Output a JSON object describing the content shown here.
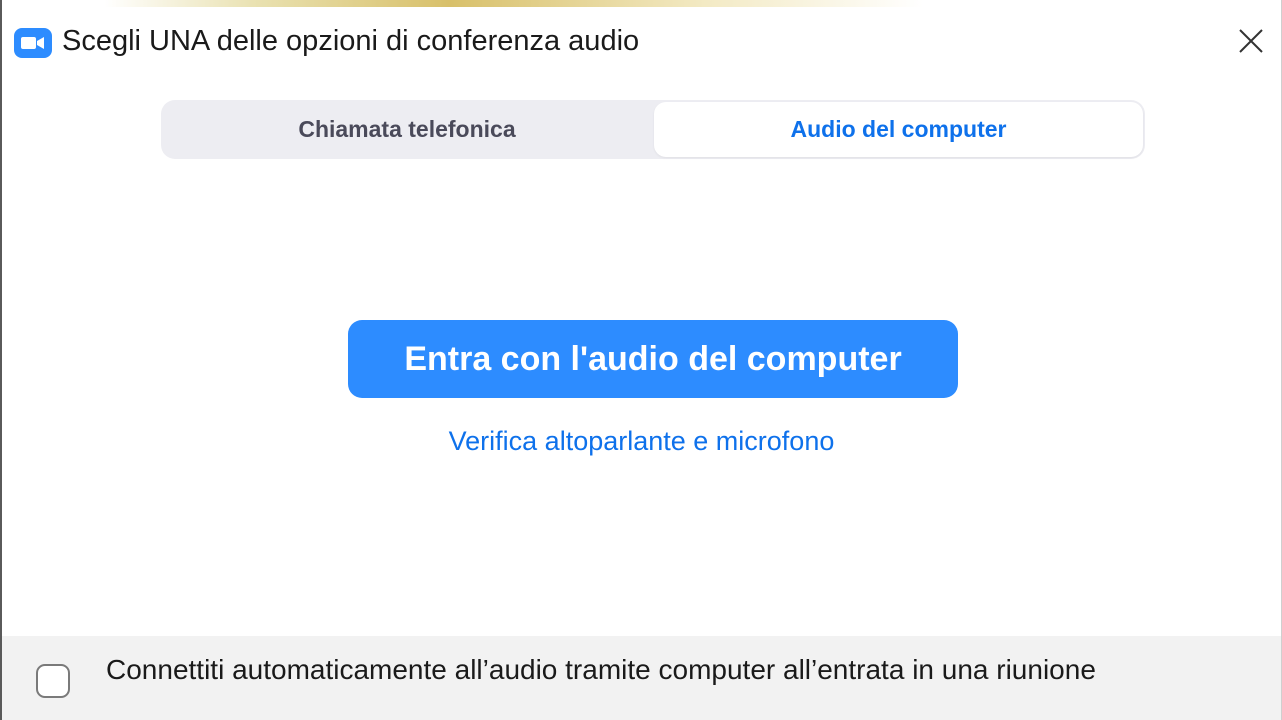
{
  "window": {
    "title": "Scegli UNA delle opzioni di conferenza audio",
    "app_icon": "video-camera-icon",
    "close_icon": "close-icon"
  },
  "tabs": [
    {
      "label": "Chiamata telefonica",
      "selected": false
    },
    {
      "label": "Audio del computer",
      "selected": true
    }
  ],
  "main": {
    "join_button_label": "Entra con l'audio del computer",
    "test_link_label": "Verifica altoparlante e microfono"
  },
  "footer": {
    "auto_connect_label": "Connettiti automaticamente all’audio tramite computer all’entrata in una riunione",
    "auto_connect_checked": false
  },
  "colors": {
    "accent": "#2d8cff",
    "link": "#0e71eb",
    "footer_bg": "#f2f2f2"
  }
}
